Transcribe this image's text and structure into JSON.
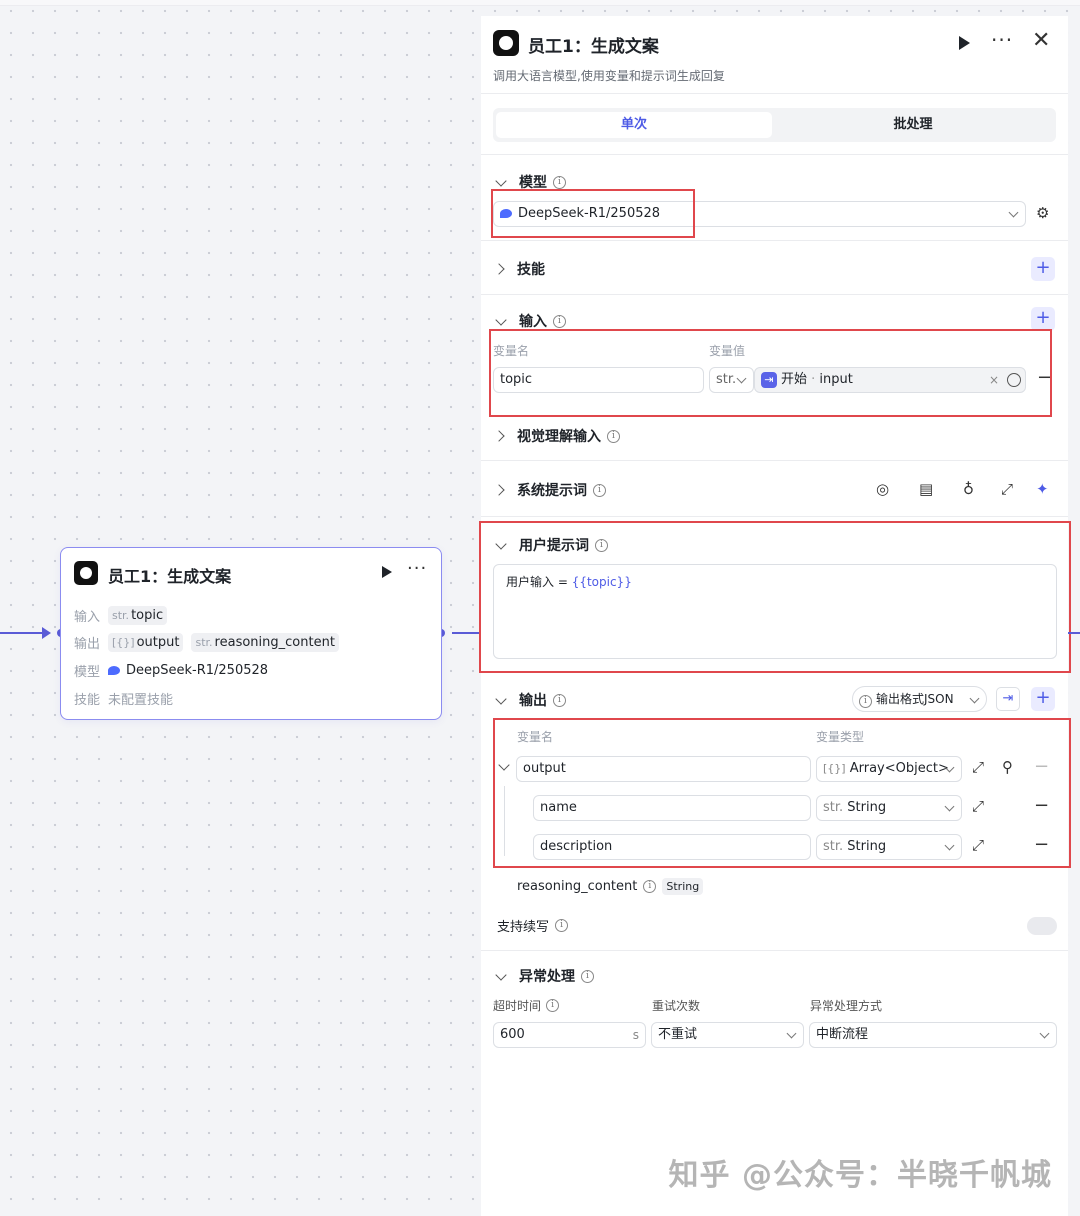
{
  "node": {
    "title": "员工1：生成文案",
    "input_label": "输入",
    "input_type": "str.",
    "input_value": "topic",
    "output_label": "输出",
    "output_type1": "[{}]",
    "output_value1": "output",
    "output_type2": "str.",
    "output_value2": "reasoning_content",
    "model_label": "模型",
    "model_value": "DeepSeek-R1/250528",
    "skill_label": "技能",
    "skill_value": "未配置技能"
  },
  "panel": {
    "title": "员工1：生成文案",
    "description": "调用大语言模型,使用变量和提示词生成回复",
    "tabs": [
      "单次",
      "批处理"
    ],
    "model_section": "模型",
    "model_value": "DeepSeek-R1/250528",
    "skills_section": "技能",
    "input_section": "输入",
    "input_col_name": "变量名",
    "input_col_value": "变量值",
    "input_var_name": "topic",
    "input_var_type": "str.",
    "input_ref_node": "开始",
    "input_ref_var": "input",
    "visual_section": "视觉理解输入",
    "system_prompt_section": "系统提示词",
    "user_prompt_section": "用户提示词",
    "user_prompt_text": "用户输入 = ",
    "user_prompt_var": "{{topic}}",
    "output_section": "输出",
    "output_format": "输出格式JSON",
    "output_col_name": "变量名",
    "output_col_type": "变量类型",
    "output_rows": [
      {
        "name": "output",
        "type_prefix": "[{}]",
        "type": "Array<Object>"
      },
      {
        "name": "name",
        "type_prefix": "str.",
        "type": "String"
      },
      {
        "name": "description",
        "type_prefix": "str.",
        "type": "String"
      }
    ],
    "reasoning_name": "reasoning_content",
    "reasoning_type": "String",
    "continue_label": "支持续写",
    "error_section": "异常处理",
    "timeout_label": "超时时间",
    "retry_label": "重试次数",
    "error_mode_label": "异常处理方式",
    "timeout_value": "600",
    "timeout_unit": "s",
    "retry_value": "不重试",
    "error_mode_value": "中断流程"
  },
  "watermark": "知乎 @公众号：半晓千帆城",
  "colors": {
    "accent": "#4e5be6",
    "connector": "#5a5bd6",
    "highlight_box": "#e0474c"
  }
}
